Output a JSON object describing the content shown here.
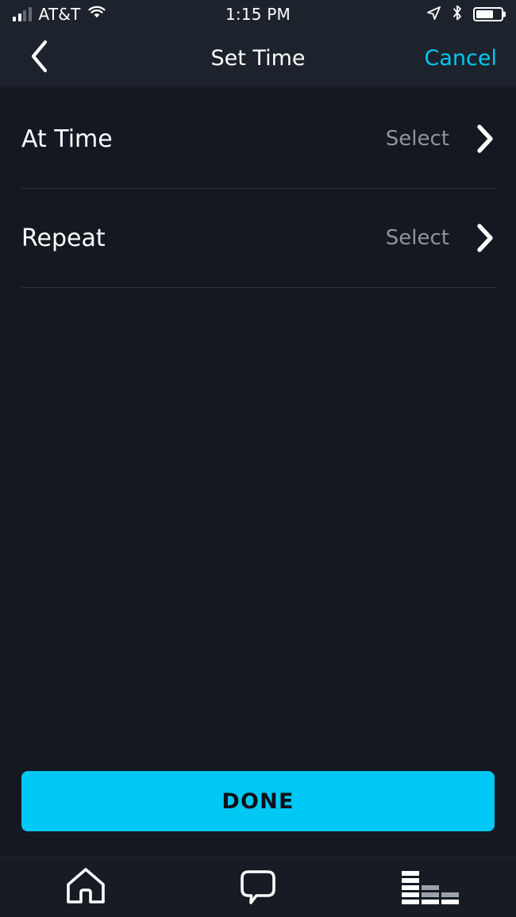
{
  "status_bar": {
    "carrier": "AT&T",
    "time": "1:15 PM",
    "signal_icon": "signal-bars-icon",
    "wifi_icon": "wifi-icon",
    "location_icon": "location-arrow-icon",
    "bluetooth_icon": "bluetooth-icon",
    "battery_icon": "battery-icon",
    "battery_level_percent": 70
  },
  "nav_bar": {
    "back_icon": "chevron-left-icon",
    "title": "Set Time",
    "cancel_label": "Cancel",
    "accent_color": "#00c8f5"
  },
  "list": {
    "rows": [
      {
        "label": "At Time",
        "value": "Select",
        "chevron_icon": "chevron-right-icon"
      },
      {
        "label": "Repeat",
        "value": "Select",
        "chevron_icon": "chevron-right-icon"
      }
    ]
  },
  "footer": {
    "done_label": "DONE",
    "done_bg_color": "#00c8f5",
    "done_text_color": "#0c1118"
  },
  "tab_bar": {
    "tabs": [
      {
        "name": "home",
        "icon": "home-icon"
      },
      {
        "name": "conversations",
        "icon": "speech-bubble-icon"
      },
      {
        "name": "activity",
        "icon": "equalizer-icon"
      }
    ]
  },
  "theme": {
    "background": "#141821",
    "bar_background": "#1d232c",
    "divider": "#2e343d",
    "muted_text": "#8e959f"
  }
}
